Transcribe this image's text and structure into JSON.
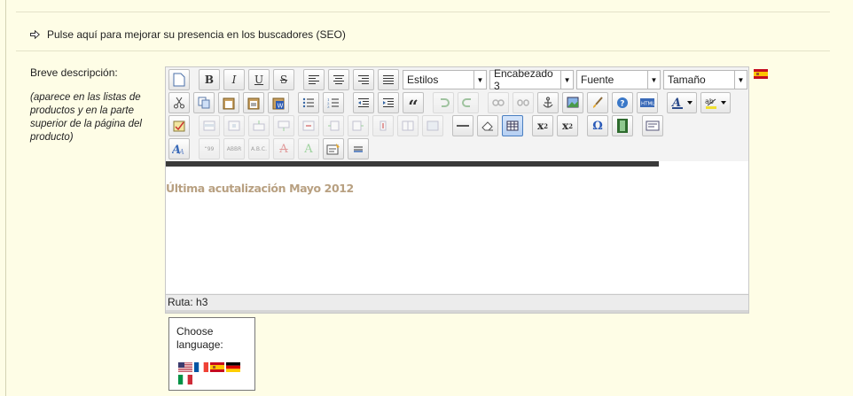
{
  "seo_link": {
    "text": "Pulse aquí para mejorar su presencia en los buscadores (SEO)",
    "icon": "arrow-right-icon"
  },
  "field": {
    "label": "Breve descripción:",
    "hint": "(aparece en las listas de productos y en la parte superior de la página del producto)"
  },
  "editor": {
    "dropdowns": {
      "styles": "Estilos",
      "format": "Encabezado 3",
      "font": "Fuente",
      "size": "Tamaño"
    },
    "content_heading": "Última acutalización Mayo 2012",
    "status_path": "Ruta: h3"
  },
  "language_chooser": {
    "title": "Choose language:",
    "flags": [
      "english-flag-icon",
      "french-flag-icon",
      "spanish-flag-icon",
      "german-flag-icon",
      "italian-flag-icon"
    ]
  },
  "colors": {
    "page_bg": "#fefde6",
    "heading_color": "#b8a081",
    "active_border": "#4a7fc1"
  }
}
